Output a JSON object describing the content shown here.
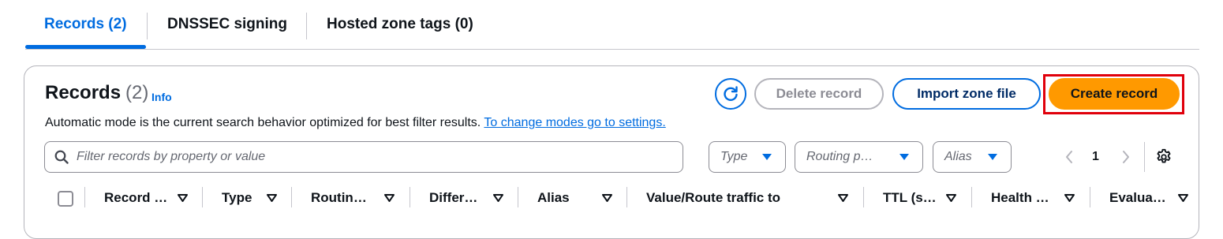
{
  "tabs": [
    {
      "label": "Records (2)",
      "active": true
    },
    {
      "label": "DNSSEC signing",
      "active": false
    },
    {
      "label": "Hosted zone tags (0)",
      "active": false
    }
  ],
  "panel": {
    "title": "Records",
    "count": "(2)",
    "info": "Info",
    "description": "Automatic mode is the current search behavior optimized for best filter results.",
    "description_link": "To change modes go to settings."
  },
  "actions": {
    "refresh_icon": "refresh-icon",
    "delete": "Delete record",
    "import": "Import zone file",
    "create": "Create record"
  },
  "filters": {
    "search_placeholder": "Filter records by property or value",
    "type": "Type",
    "routing": "Routing p…",
    "alias": "Alias"
  },
  "pagination": {
    "current": "1"
  },
  "columns": [
    "Record …",
    "Type",
    "Routin…",
    "Differ…",
    "Alias",
    "Value/Route traffic to",
    "TTL (s…",
    "Health …",
    "Evalua…"
  ],
  "colors": {
    "accent": "#006ce0",
    "primary_button": "#ff9900",
    "highlight": "#e0000b"
  }
}
